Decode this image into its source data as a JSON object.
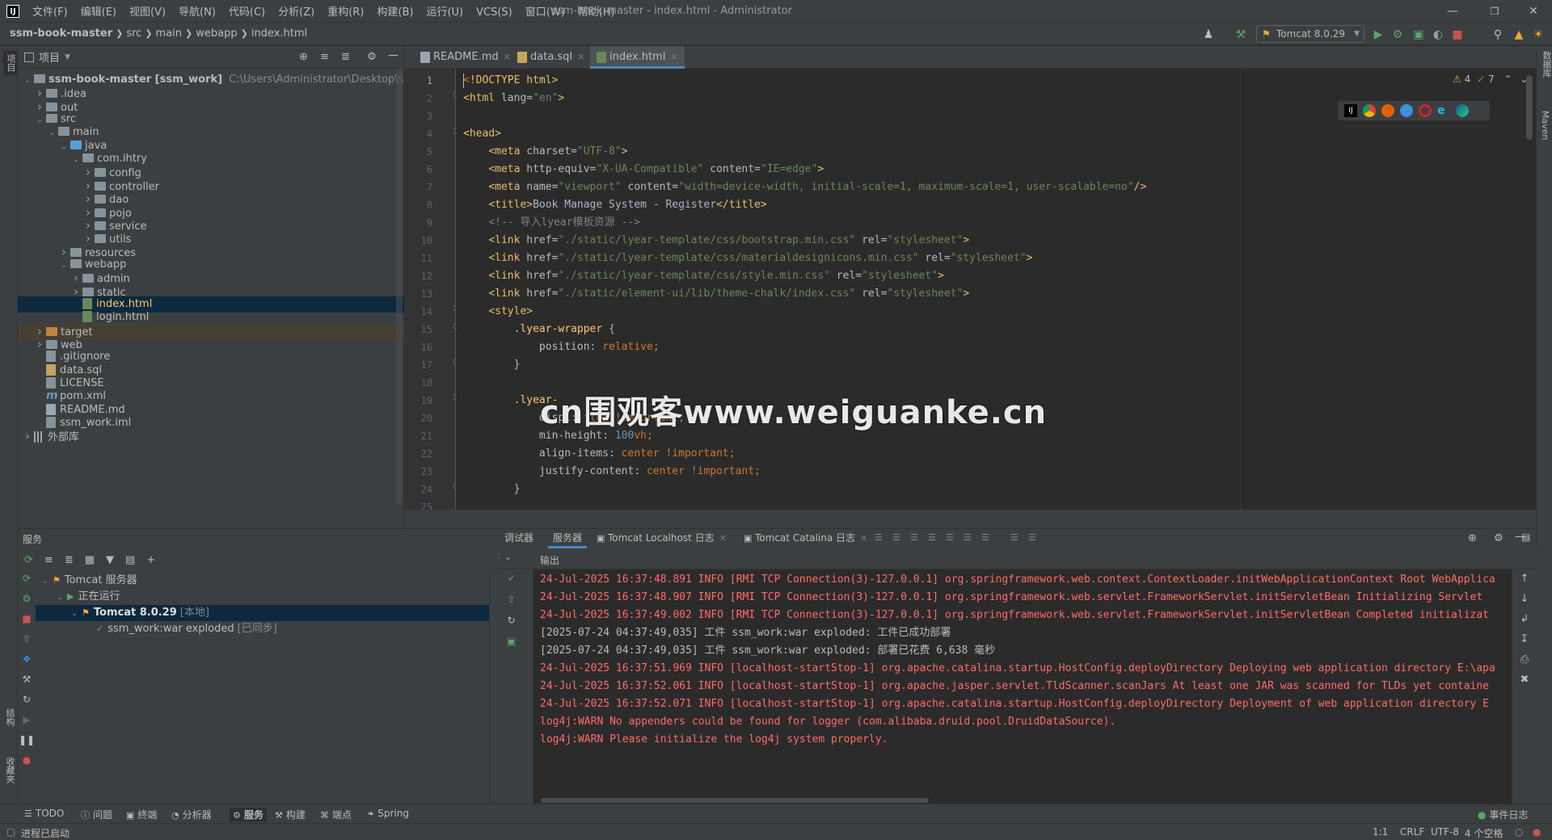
{
  "window": {
    "title": "ssm-book-master - index.html - Administrator",
    "menu": [
      "文件(F)",
      "编辑(E)",
      "视图(V)",
      "导航(N)",
      "代码(C)",
      "分析(Z)",
      "重构(R)",
      "构建(B)",
      "运行(U)",
      "VCS(S)",
      "窗口(W)",
      "帮助(H)"
    ]
  },
  "breadcrumb": [
    "ssm-book-master",
    "src",
    "main",
    "webapp",
    "index.html"
  ],
  "toolbar": {
    "run_config": "Tomcat 8.0.29"
  },
  "left_stripe": {
    "project": "项目",
    "structure": "结构",
    "bookmarks": "收藏夹"
  },
  "right_stripe": {
    "database": "数据库",
    "maven": "Maven"
  },
  "project_panel": {
    "title": "项目",
    "tree": [
      {
        "label": "ssm-book-master [ssm_work]",
        "extra": "C:\\Users\\Administrator\\Desktop\\ssm-book",
        "depth": 0,
        "arrow": "down",
        "kind": "folder"
      },
      {
        "label": ".idea",
        "depth": 1,
        "arrow": "right",
        "kind": "folder"
      },
      {
        "label": "out",
        "depth": 1,
        "arrow": "right",
        "kind": "folder"
      },
      {
        "label": "src",
        "depth": 1,
        "arrow": "down",
        "kind": "folder"
      },
      {
        "label": "main",
        "depth": 2,
        "arrow": "down",
        "kind": "folder"
      },
      {
        "label": "java",
        "depth": 3,
        "arrow": "down",
        "kind": "folder-blue"
      },
      {
        "label": "com.ihtry",
        "depth": 4,
        "arrow": "down",
        "kind": "folder"
      },
      {
        "label": "config",
        "depth": 5,
        "arrow": "right",
        "kind": "folder"
      },
      {
        "label": "controller",
        "depth": 5,
        "arrow": "right",
        "kind": "folder"
      },
      {
        "label": "dao",
        "depth": 5,
        "arrow": "right",
        "kind": "folder"
      },
      {
        "label": "pojo",
        "depth": 5,
        "arrow": "right",
        "kind": "folder"
      },
      {
        "label": "service",
        "depth": 5,
        "arrow": "right",
        "kind": "folder"
      },
      {
        "label": "utils",
        "depth": 5,
        "arrow": "right",
        "kind": "folder"
      },
      {
        "label": "resources",
        "depth": 3,
        "arrow": "right",
        "kind": "folder"
      },
      {
        "label": "webapp",
        "depth": 3,
        "arrow": "down",
        "kind": "folder"
      },
      {
        "label": "admin",
        "depth": 4,
        "arrow": "right",
        "kind": "folder"
      },
      {
        "label": "static",
        "depth": 4,
        "arrow": "right",
        "kind": "folder"
      },
      {
        "label": "index.html",
        "depth": 4,
        "arrow": "",
        "kind": "html",
        "selected": true
      },
      {
        "label": "login.html",
        "depth": 4,
        "arrow": "",
        "kind": "html"
      },
      {
        "label": "target",
        "depth": 1,
        "arrow": "right",
        "kind": "folder-orange",
        "highlight": true
      },
      {
        "label": "web",
        "depth": 1,
        "arrow": "right",
        "kind": "folder"
      },
      {
        "label": ".gitignore",
        "depth": 1,
        "arrow": "",
        "kind": "file"
      },
      {
        "label": "data.sql",
        "depth": 1,
        "arrow": "",
        "kind": "sql"
      },
      {
        "label": "LICENSE",
        "depth": 1,
        "arrow": "",
        "kind": "file"
      },
      {
        "label": "pom.xml",
        "depth": 1,
        "arrow": "",
        "kind": "maven"
      },
      {
        "label": "README.md",
        "depth": 1,
        "arrow": "",
        "kind": "md"
      },
      {
        "label": "ssm_work.iml",
        "depth": 1,
        "arrow": "",
        "kind": "file"
      },
      {
        "label": "外部库",
        "depth": 0,
        "arrow": "right",
        "kind": "lib"
      }
    ]
  },
  "editor": {
    "tabs": [
      {
        "label": "README.md",
        "active": false
      },
      {
        "label": "data.sql",
        "active": false
      },
      {
        "label": "index.html",
        "active": true
      }
    ],
    "inspections": {
      "warnings": "4",
      "ok": "7"
    },
    "lines": [
      [
        [
          "kw",
          "<"
        ],
        [
          "tag",
          "!DOCTYPE html"
        ],
        [
          "tag",
          ">"
        ]
      ],
      [
        [
          "tag",
          "<html "
        ],
        [
          "attr",
          "lang="
        ],
        [
          "str",
          "\"en\""
        ],
        [
          "tag",
          ">"
        ]
      ],
      [],
      [
        [
          "tag",
          "<head>"
        ]
      ],
      [
        [
          "",
          "    "
        ],
        [
          "tag",
          "<meta "
        ],
        [
          "attr",
          "charset="
        ],
        [
          "str",
          "\"UTF-8\""
        ],
        [
          "tag",
          ">"
        ]
      ],
      [
        [
          "",
          "    "
        ],
        [
          "tag",
          "<meta "
        ],
        [
          "attr",
          "http-equiv="
        ],
        [
          "str",
          "\"X-UA-Compatible\" "
        ],
        [
          "attr",
          "content="
        ],
        [
          "str",
          "\"IE=edge\""
        ],
        [
          "tag",
          ">"
        ]
      ],
      [
        [
          "",
          "    "
        ],
        [
          "tag",
          "<meta "
        ],
        [
          "attr",
          "name="
        ],
        [
          "str",
          "\"viewport\" "
        ],
        [
          "attr",
          "content="
        ],
        [
          "str",
          "\"width=device-width, initial-scale=1, maximum-scale=1, user-scalable=no\""
        ],
        [
          "tag",
          "/>"
        ]
      ],
      [
        [
          "",
          "    "
        ],
        [
          "tag",
          "<title>"
        ],
        [
          "",
          "Book Manage System - Register"
        ],
        [
          "tag",
          "</title>"
        ]
      ],
      [
        [
          "",
          "    "
        ],
        [
          "cmt",
          "<!-- 导入lyear模板资源 -->"
        ]
      ],
      [
        [
          "",
          "    "
        ],
        [
          "tag",
          "<link "
        ],
        [
          "attr",
          "href="
        ],
        [
          "str",
          "\"./static/lyear-template/css/bootstrap.min.css\" "
        ],
        [
          "attr",
          "rel="
        ],
        [
          "str",
          "\"stylesheet\""
        ],
        [
          "tag",
          ">"
        ]
      ],
      [
        [
          "",
          "    "
        ],
        [
          "tag",
          "<link "
        ],
        [
          "attr",
          "href="
        ],
        [
          "str",
          "\"./static/lyear-template/css/materialdesignicons.min.css\" "
        ],
        [
          "attr",
          "rel="
        ],
        [
          "str",
          "\"stylesheet\""
        ],
        [
          "tag",
          ">"
        ]
      ],
      [
        [
          "",
          "    "
        ],
        [
          "tag",
          "<link "
        ],
        [
          "attr",
          "href="
        ],
        [
          "str",
          "\"./static/lyear-template/css/style.min.css\" "
        ],
        [
          "attr",
          "rel="
        ],
        [
          "str",
          "\"stylesheet\""
        ],
        [
          "tag",
          ">"
        ]
      ],
      [
        [
          "",
          "    "
        ],
        [
          "tag",
          "<link "
        ],
        [
          "attr",
          "href="
        ],
        [
          "str",
          "\"./static/element-ui/lib/theme-chalk/index.css\" "
        ],
        [
          "attr",
          "rel="
        ],
        [
          "str",
          "\"stylesheet\""
        ],
        [
          "tag",
          ">"
        ]
      ],
      [
        [
          "",
          "    "
        ],
        [
          "tag",
          "<style>"
        ]
      ],
      [
        [
          "",
          "        "
        ],
        [
          "sel",
          ".lyear-wrapper"
        ],
        [
          "",
          " {"
        ]
      ],
      [
        [
          "",
          "            "
        ],
        [
          "attr",
          "position"
        ],
        [
          "",
          ": "
        ],
        [
          "kw",
          "relative"
        ],
        [
          "kw",
          ";"
        ]
      ],
      [
        [
          "",
          "        }"
        ]
      ],
      [],
      [
        [
          "",
          "        "
        ],
        [
          "sel",
          ".lyear-"
        ]
      ],
      [
        [
          "",
          "            "
        ],
        [
          "attr",
          "displ"
        ],
        [
          "",
          ": "
        ],
        [
          "kw",
          "flex !important"
        ],
        [
          "kw",
          ";"
        ]
      ],
      [
        [
          "",
          "            "
        ],
        [
          "attr",
          "min-height"
        ],
        [
          "",
          ": "
        ],
        [
          "num",
          "100"
        ],
        [
          "kw",
          "vh"
        ],
        [
          "kw",
          ";"
        ]
      ],
      [
        [
          "",
          "            "
        ],
        [
          "attr",
          "align-items"
        ],
        [
          "",
          ": "
        ],
        [
          "kw",
          "center !important"
        ],
        [
          "kw",
          ";"
        ]
      ],
      [
        [
          "",
          "            "
        ],
        [
          "attr",
          "justify-content"
        ],
        [
          "",
          ": "
        ],
        [
          "kw",
          "center !important"
        ],
        [
          "kw",
          ";"
        ]
      ],
      [
        [
          "",
          "        }"
        ]
      ],
      []
    ]
  },
  "watermark": "cn围观客www.weiguanke.cn",
  "services": {
    "title": "服务",
    "tree": [
      {
        "label": "Tomcat 服务器",
        "depth": 0
      },
      {
        "label": "正在运行",
        "depth": 1
      },
      {
        "label": "Tomcat 8.0.29",
        "extra": "[本地]",
        "depth": 2,
        "selected": true
      },
      {
        "label": "ssm_work:war exploded",
        "extra": "[已同步]",
        "depth": 3
      }
    ],
    "console_tabs": [
      "调试器",
      "服务器",
      "Tomcat Localhost 日志",
      "Tomcat Catalina 日志"
    ],
    "output_label": "输出",
    "log": [
      {
        "text": "24-Jul-2025 16:37:48.891 INFO [RMI TCP Connection(3)-127.0.0.1] org.springframework.web.context.ContextLoader.initWebApplicationContext Root WebApplica",
        "red": true
      },
      {
        "text": "24-Jul-2025 16:37:48.907 INFO [RMI TCP Connection(3)-127.0.0.1] org.springframework.web.servlet.FrameworkServlet.initServletBean Initializing Servlet",
        "red": true
      },
      {
        "text": "24-Jul-2025 16:37:49.002 INFO [RMI TCP Connection(3)-127.0.0.1] org.springframework.web.servlet.FrameworkServlet.initServletBean Completed initializat",
        "red": true
      },
      {
        "text": "[2025-07-24 04:37:49,035] 工件 ssm_work:war exploded: 工件已成功部署",
        "red": false
      },
      {
        "text": "[2025-07-24 04:37:49,035] 工件 ssm_work:war exploded: 部署已花费 6,638 毫秒",
        "red": false
      },
      {
        "text": "24-Jul-2025 16:37:51.969 INFO [localhost-startStop-1] org.apache.catalina.startup.HostConfig.deployDirectory Deploying web application directory E:\\apa",
        "red": true
      },
      {
        "text": "24-Jul-2025 16:37:52.061 INFO [localhost-startStop-1] org.apache.jasper.servlet.TldScanner.scanJars At least one JAR was scanned for TLDs yet containe",
        "red": true
      },
      {
        "text": "24-Jul-2025 16:37:52.071 INFO [localhost-startStop-1] org.apache.catalina.startup.HostConfig.deployDirectory Deployment of web application directory E",
        "red": true
      },
      {
        "text": "log4j:WARN No appenders could be found for logger (com.alibaba.druid.pool.DruidDataSource).",
        "red": true
      },
      {
        "text": "log4j:WARN Please initialize the log4j system properly.",
        "red": true
      }
    ]
  },
  "bottom_tools": [
    "TODO",
    "问题",
    "终端",
    "分析器",
    "服务",
    "构建",
    "端点",
    "Spring"
  ],
  "event_log": "事件日志",
  "status": {
    "message": "进程已启动",
    "position": "1:1",
    "line_sep": "CRLF",
    "encoding": "UTF-8",
    "indent": "4 个空格"
  },
  "colors": {
    "accent": "#4a88c7",
    "error_text": "#ff6b68",
    "selection": "#0d293e"
  }
}
